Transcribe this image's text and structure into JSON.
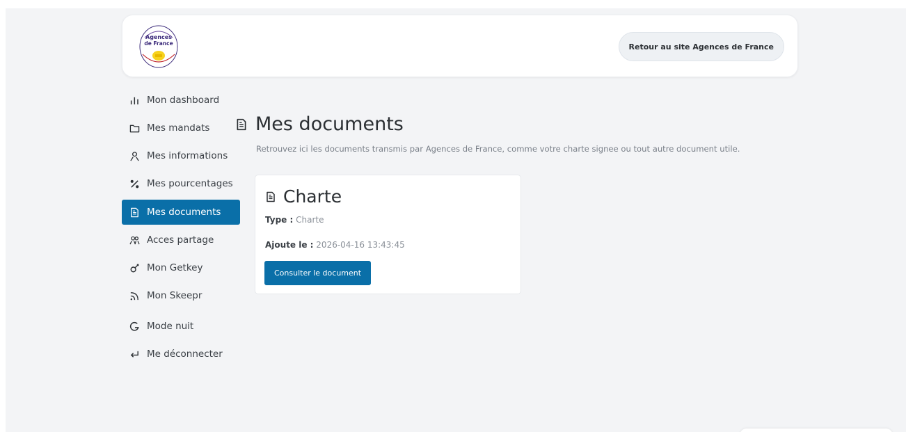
{
  "header": {
    "logo": {
      "line1": "Agences",
      "line2": "de France",
      "colors": {
        "ring": "#3b2a7a",
        "ring_alt": "#c1272d",
        "sun": "#f7d21e"
      }
    },
    "back_button_label": "Retour au site Agences de France"
  },
  "sidebar": {
    "items": [
      {
        "label": "Mon dashboard",
        "icon": "bar-chart-icon",
        "active": false
      },
      {
        "label": "Mes mandats",
        "icon": "folder-icon",
        "active": false
      },
      {
        "label": "Mes informations",
        "icon": "user-icon",
        "active": false
      },
      {
        "label": "Mes pourcentages",
        "icon": "percent-icon",
        "active": false
      },
      {
        "label": "Mes documents",
        "icon": "document-icon",
        "active": true
      },
      {
        "label": "Acces partage",
        "icon": "users-icon",
        "active": false
      },
      {
        "label": "Mon Getkey",
        "icon": "key-icon",
        "active": false
      },
      {
        "label": "Mon Skeepr",
        "icon": "rss-icon",
        "active": false
      },
      {
        "label": "Mode nuit",
        "icon": "moon-icon",
        "active": false
      },
      {
        "label": "Me déconnecter",
        "icon": "logout-arrow-icon",
        "active": false
      }
    ],
    "active_color": "#0a6fa8"
  },
  "main": {
    "title": "Mes documents",
    "subtitle": "Retrouvez ici les documents transmis par Agences de France, comme votre charte signee ou tout autre document utile.",
    "documents": [
      {
        "title": "Charte",
        "type_label": "Type :",
        "type_value": "Charte",
        "added_label": "Ajoute le :",
        "added_value": "2026-04-16 13:43:45",
        "button_label": "Consulter le document"
      }
    ]
  }
}
